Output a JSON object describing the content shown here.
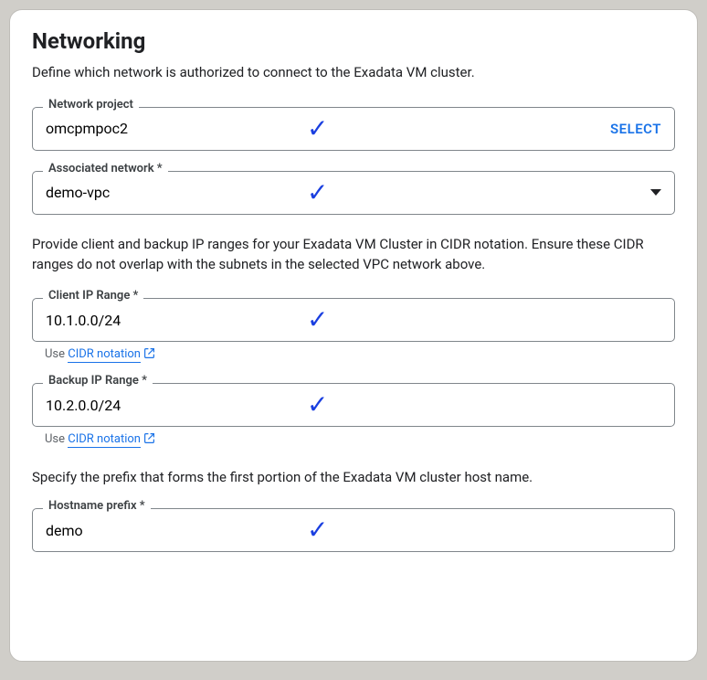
{
  "heading": "Networking",
  "intro": "Define which network is authorized to connect to the Exadata VM cluster.",
  "fields": {
    "network_project": {
      "label": "Network project",
      "value": "omcpmpoc2",
      "action": "SELECT"
    },
    "associated_network": {
      "label": "Associated network *",
      "value": "demo-vpc"
    },
    "client_ip_range": {
      "label": "Client IP Range *",
      "value": "10.1.0.0/24"
    },
    "backup_ip_range": {
      "label": "Backup IP Range *",
      "value": "10.2.0.0/24"
    },
    "hostname_prefix": {
      "label": "Hostname prefix *",
      "value": "demo"
    }
  },
  "ip_ranges_desc": "Provide client and backup IP ranges for your Exadata VM Cluster in CIDR notation. Ensure these CIDR ranges do not overlap with the subnets in the selected VPC network above.",
  "cidr_hint_prefix": "Use ",
  "cidr_hint_link": "CIDR notation",
  "hostname_desc": "Specify the prefix that forms the first portion of the Exadata VM cluster host name."
}
